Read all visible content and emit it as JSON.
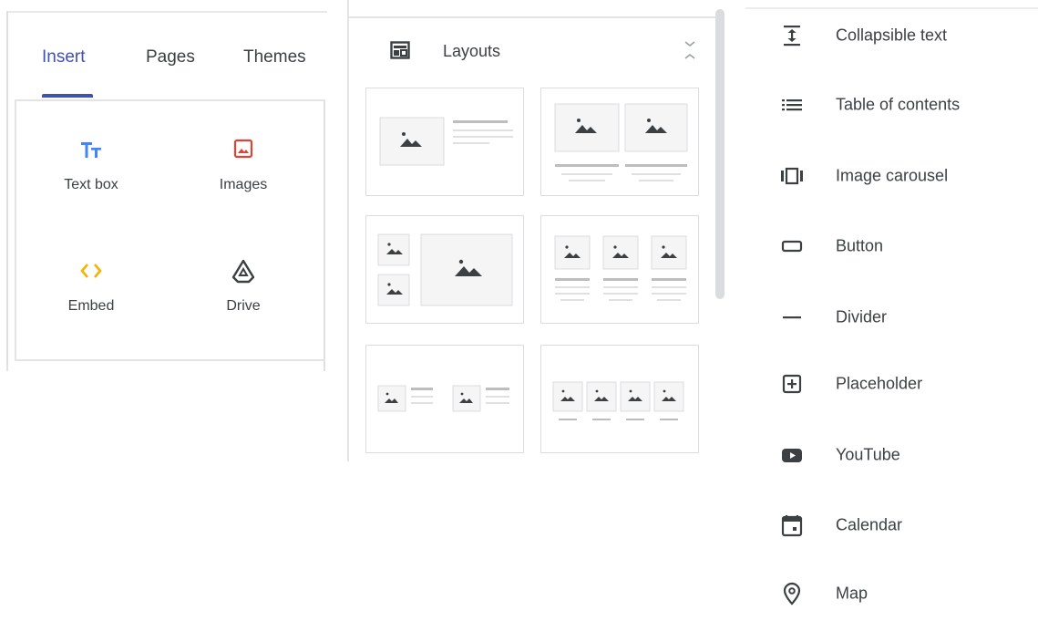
{
  "insert_panel": {
    "tabs": [
      {
        "label": "Insert",
        "active": true
      },
      {
        "label": "Pages",
        "active": false
      },
      {
        "label": "Themes",
        "active": false
      }
    ],
    "tiles": [
      {
        "label": "Text box",
        "icon": "text-box-icon",
        "icon_color": "#4285f4"
      },
      {
        "label": "Images",
        "icon": "image-icon",
        "icon_color": "#db4437"
      },
      {
        "label": "Embed",
        "icon": "embed-icon",
        "icon_color": "#f4b400"
      },
      {
        "label": "Drive",
        "icon": "drive-icon",
        "icon_color": "#3c4043"
      }
    ],
    "accent_color": "#3f51b5"
  },
  "layouts_panel": {
    "title": "Layouts",
    "icon": "layouts-icon",
    "collapse_icon": "collapse-chevron-icon",
    "cards": [
      {
        "name": "image-left-text"
      },
      {
        "name": "two-images-with-text"
      },
      {
        "name": "two-small-one-large-image"
      },
      {
        "name": "three-images-with-text"
      },
      {
        "name": "two-image-text-pairs"
      },
      {
        "name": "four-images-with-captions"
      }
    ]
  },
  "blocks_panel": {
    "items": [
      {
        "label": "Collapsible text",
        "icon": "collapsible-text-icon"
      },
      {
        "label": "Table of contents",
        "icon": "table-of-contents-icon"
      },
      {
        "label": "Image carousel",
        "icon": "image-carousel-icon"
      },
      {
        "label": "Button",
        "icon": "button-icon"
      },
      {
        "label": "Divider",
        "icon": "divider-icon"
      },
      {
        "label": "Placeholder",
        "icon": "placeholder-icon"
      },
      {
        "label": "YouTube",
        "icon": "youtube-icon"
      },
      {
        "label": "Calendar",
        "icon": "calendar-icon"
      },
      {
        "label": "Map",
        "icon": "map-icon"
      }
    ]
  }
}
